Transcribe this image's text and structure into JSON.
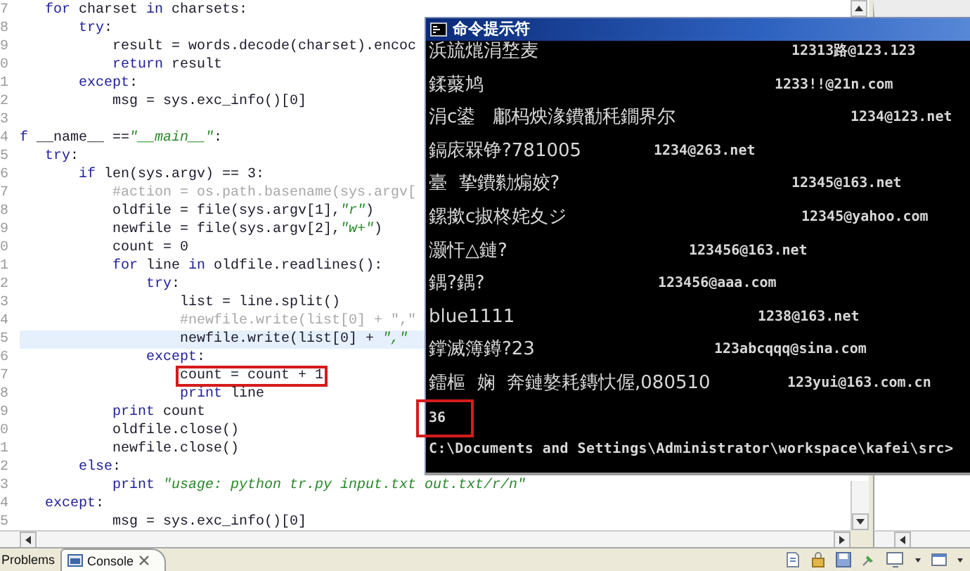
{
  "editor": {
    "lines": [
      {
        "number": "7",
        "highlighted": false,
        "tokens": [
          {
            "kind": "keyword",
            "text": "   for"
          },
          {
            "kind": "plain",
            "text": " charset "
          },
          {
            "kind": "keyword",
            "text": "in"
          },
          {
            "kind": "plain",
            "text": " charsets:"
          }
        ]
      },
      {
        "number": "8",
        "highlighted": false,
        "tokens": [
          {
            "kind": "keyword",
            "text": "       try"
          },
          {
            "kind": "plain",
            "text": ":"
          }
        ]
      },
      {
        "number": "9",
        "highlighted": false,
        "tokens": [
          {
            "kind": "plain",
            "text": "           result = words.decode(charset).encoc"
          }
        ]
      },
      {
        "number": "0",
        "highlighted": false,
        "tokens": [
          {
            "kind": "keyword",
            "text": "           return"
          },
          {
            "kind": "plain",
            "text": " result"
          }
        ]
      },
      {
        "number": "1",
        "highlighted": false,
        "tokens": [
          {
            "kind": "keyword",
            "text": "       except"
          },
          {
            "kind": "plain",
            "text": ":"
          }
        ]
      },
      {
        "number": "2",
        "highlighted": false,
        "tokens": [
          {
            "kind": "plain",
            "text": "           msg = sys.exc_info()[0]"
          }
        ]
      },
      {
        "number": "3",
        "highlighted": false
      },
      {
        "number": "4",
        "highlighted": false,
        "tokens": [
          {
            "kind": "keyword",
            "text": "f"
          },
          {
            "kind": "plain",
            "text": " __name__ =="
          },
          {
            "kind": "string",
            "text": "\"__main__\""
          },
          {
            "kind": "plain",
            "text": ":"
          }
        ]
      },
      {
        "number": "5",
        "highlighted": false,
        "tokens": [
          {
            "kind": "keyword",
            "text": "   try"
          },
          {
            "kind": "plain",
            "text": ":"
          }
        ]
      },
      {
        "number": "6",
        "highlighted": false,
        "tokens": [
          {
            "kind": "keyword",
            "text": "       if"
          },
          {
            "kind": "plain",
            "text": " len(sys.argv) == 3:"
          }
        ]
      },
      {
        "number": "7",
        "highlighted": false,
        "tokens": [
          {
            "kind": "comment",
            "text": "           #action = os.path.basename(sys.argv["
          }
        ]
      },
      {
        "number": "8",
        "highlighted": false,
        "tokens": [
          {
            "kind": "plain",
            "text": "           oldfile = file(sys.argv[1],"
          },
          {
            "kind": "string",
            "text": "\"r\""
          },
          {
            "kind": "plain",
            "text": ")"
          }
        ]
      },
      {
        "number": "9",
        "highlighted": false,
        "tokens": [
          {
            "kind": "plain",
            "text": "           newfile = file(sys.argv[2],"
          },
          {
            "kind": "string",
            "text": "\"w+\""
          },
          {
            "kind": "plain",
            "text": ")"
          }
        ]
      },
      {
        "number": "0",
        "highlighted": false,
        "tokens": [
          {
            "kind": "plain",
            "text": "           count = 0"
          }
        ]
      },
      {
        "number": "1",
        "highlighted": false,
        "tokens": [
          {
            "kind": "keyword",
            "text": "           for"
          },
          {
            "kind": "plain",
            "text": " line "
          },
          {
            "kind": "keyword",
            "text": "in"
          },
          {
            "kind": "plain",
            "text": " oldfile.readlines():"
          }
        ]
      },
      {
        "number": "2",
        "highlighted": false,
        "tokens": [
          {
            "kind": "keyword",
            "text": "               try"
          },
          {
            "kind": "plain",
            "text": ":"
          }
        ]
      },
      {
        "number": "3",
        "highlighted": false,
        "tokens": [
          {
            "kind": "plain",
            "text": "                   list = line.split()"
          }
        ]
      },
      {
        "number": "4",
        "highlighted": false,
        "tokens": [
          {
            "kind": "comment",
            "text": "                   #newfile.write(list[0] + \",\""
          }
        ]
      },
      {
        "number": "5",
        "highlighted": true,
        "tokens": [
          {
            "kind": "plain",
            "text": "                   newfile.write(list[0] + "
          },
          {
            "kind": "string",
            "text": "\",\""
          }
        ]
      },
      {
        "number": "6",
        "highlighted": false,
        "tokens": [
          {
            "kind": "keyword",
            "text": "               except"
          },
          {
            "kind": "plain",
            "text": ":"
          }
        ]
      },
      {
        "number": "7",
        "highlighted": false,
        "boxed": true,
        "tokens": [
          {
            "kind": "plain",
            "text": "                   count = count + 1"
          }
        ]
      },
      {
        "number": "8",
        "highlighted": false,
        "tokens": [
          {
            "kind": "keyword",
            "text": "                   print"
          },
          {
            "kind": "plain",
            "text": " line"
          }
        ]
      },
      {
        "number": "9",
        "highlighted": false,
        "tokens": [
          {
            "kind": "keyword",
            "text": "           print"
          },
          {
            "kind": "plain",
            "text": " count"
          }
        ]
      },
      {
        "number": "0",
        "highlighted": false,
        "tokens": [
          {
            "kind": "plain",
            "text": "           oldfile.close()"
          }
        ]
      },
      {
        "number": "1",
        "highlighted": false,
        "tokens": [
          {
            "kind": "plain",
            "text": "           newfile.close()"
          }
        ]
      },
      {
        "number": "2",
        "highlighted": false,
        "tokens": [
          {
            "kind": "keyword",
            "text": "       else"
          },
          {
            "kind": "plain",
            "text": ":"
          }
        ]
      },
      {
        "number": "3",
        "highlighted": false,
        "tokens": [
          {
            "kind": "keyword",
            "text": "           print"
          },
          {
            "kind": "string",
            "text": " \"usage: python tr.py input.txt out.txt/r/n\""
          }
        ]
      },
      {
        "number": "4",
        "highlighted": false,
        "tokens": [
          {
            "kind": "keyword",
            "text": "   except"
          },
          {
            "kind": "plain",
            "text": ":"
          }
        ]
      },
      {
        "number": "5",
        "highlighted": false,
        "tokens": [
          {
            "kind": "plain",
            "text": "           msg = sys.exc_info()[0]"
          }
        ]
      }
    ]
  },
  "console_window": {
    "title": "命令提示符",
    "rows": [
      {
        "name": "浜旈熴涓堥麦",
        "email": "12313路@123.123"
      },
      {
        "name": "鍒藂鸠",
        "email": "1233!!@21n.com"
      },
      {
        "name": "涓c鍙   鄘杩炴湪鐨勫秏鐗界尔",
        "email": "1234@123.net"
      },
      {
        "name": "鎘庡槑铮?781005",
        "email": "1234@263.net"
      },
      {
        "name": "臺  挚鐨勬煽姣?",
        "email": "12345@163.net"
      },
      {
        "name": "鏍撳c掓柊姹夊ジ",
        "email": "12345@yahoo.com"
      },
      {
        "name": "灏忓△鏈?",
        "email": "123456@163.net"
      },
      {
        "name": "鍝?鍝?",
        "email": "123456@aaa.com"
      },
      {
        "name": "blue1111",
        "email": "1238@163.net"
      },
      {
        "name": "鐣滅簿鐏?23",
        "email": "123abcqqq@sina.com"
      },
      {
        "name": "鐳樞  娴  奔鏈嫯耗鏄忕偓,080510",
        "email": "123yui@163.com.cn"
      }
    ],
    "count": "36",
    "count_boxed": true,
    "prompt": "C:\\Documents and Settings\\Administrator\\workspace\\kafei\\src>"
  },
  "bottom_tabs": [
    {
      "label": "Problems",
      "selected": false
    },
    {
      "label": "Console",
      "selected": true
    }
  ]
}
